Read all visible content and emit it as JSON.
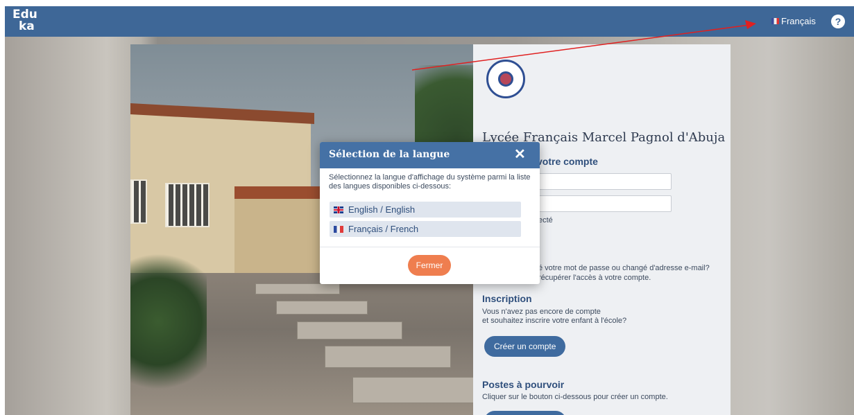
{
  "header": {
    "logo_line1": "Edu",
    "logo_line2": "ka",
    "language_label": "Français",
    "help_label": "?"
  },
  "login_panel": {
    "school_name": "Lycée Français Marcel Pagnol d'Abuja",
    "login_title": "votre compte",
    "stay_connected": "ecté",
    "forgot_line1": "é votre mot de passe ou changé d'adresse e-mail?",
    "forgot_line2": "récupérer l'accès à votre compte.",
    "signup_title": "Inscription",
    "signup_text1": "Vous n'avez pas encore de compte",
    "signup_text2": "et souhaitez inscrire votre enfant à l'école?",
    "signup_button": "Créer un compte",
    "jobs_title": "Postes à pourvoir",
    "jobs_text": "Cliquer sur le bouton ci-dessous pour créer un compte."
  },
  "modal": {
    "title": "Sélection de la langue",
    "close": "✕",
    "description": "Sélectionnez la langue d'affichage du système parmi la liste des langues disponibles ci-dessous:",
    "languages": [
      {
        "label": "English / English",
        "flag": "uk-flag-icon"
      },
      {
        "label": "Français / French",
        "flag": "fr-flag-icon"
      }
    ],
    "close_button": "Fermer"
  },
  "colors": {
    "topbar": "#3e6797",
    "modal_header": "#4571a5",
    "close_button": "#ef7e4f",
    "primary_button": "#3f6b9f",
    "annotation_arrow": "#e02020"
  }
}
